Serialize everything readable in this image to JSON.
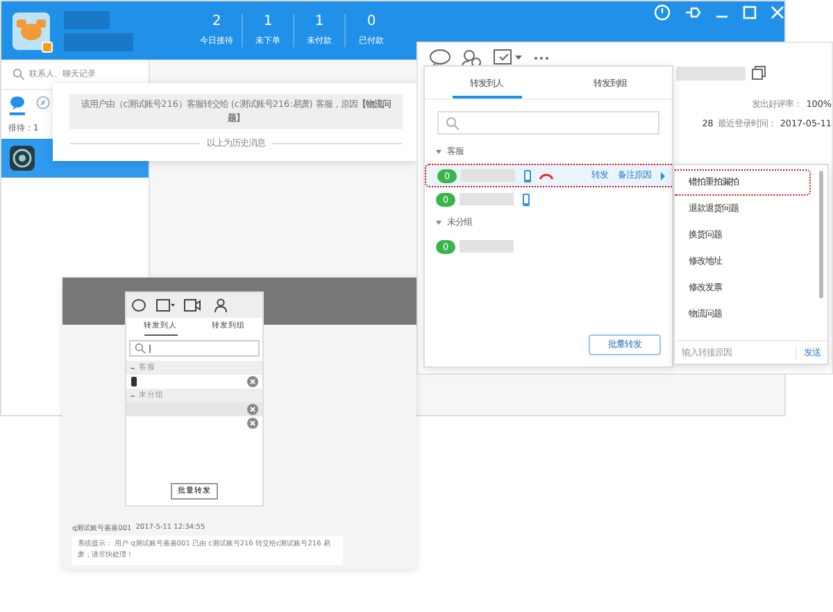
{
  "main_window": {
    "stats": [
      {
        "value": "2",
        "label": "今日接待"
      },
      {
        "value": "1",
        "label": "未下单"
      },
      {
        "value": "1",
        "label": "未付款"
      },
      {
        "value": "0",
        "label": "已付款"
      }
    ],
    "search": {
      "placeholder": "联系人、聊天记录"
    },
    "sidebar_tabs": [
      {
        "kind": "chat",
        "selected": true
      },
      {
        "kind": "compass",
        "selected": false
      }
    ],
    "queue_label": "排待：1",
    "contacts": [
      {
        "selected": true
      }
    ]
  },
  "history_popup": {
    "message": "该用户由（c测试账号216）客服转交给 (c测试账号216:易萧) 客服，原因**【物流问题】**",
    "divider": "以上为历史消息"
  },
  "chat_window": {
    "date_fragment": "28",
    "info": [
      {
        "label": "发出好评率：",
        "value": "100%"
      },
      {
        "label": "最近登录时间：",
        "value": "2017-05-11"
      }
    ]
  },
  "forward_panel": {
    "tabs": [
      {
        "label": "转发到人",
        "selected": true
      },
      {
        "label": "转发到组",
        "selected": false
      }
    ],
    "groups": [
      {
        "name": "客服",
        "expanded": true,
        "members": [
          {
            "count": "0",
            "kind": "mobile",
            "selected": true,
            "actions": [
              "转发",
              "备注原因"
            ]
          },
          {
            "count": "0",
            "kind": "mobile",
            "selected": false
          }
        ]
      },
      {
        "name": "未分组",
        "expanded": true,
        "members": [
          {
            "count": "0",
            "kind": "plain",
            "selected": false
          }
        ]
      }
    ],
    "batch_button": "批量转发"
  },
  "reason_menu": {
    "items": [
      {
        "label": "错拍重拍漏拍",
        "highlighted": true
      },
      {
        "label": "退款退货问题",
        "highlighted": false
      },
      {
        "label": "换货问题",
        "highlighted": false
      },
      {
        "label": "修改地址",
        "highlighted": false
      },
      {
        "label": "修改发票",
        "highlighted": false
      },
      {
        "label": "物流问题",
        "highlighted": false
      }
    ],
    "input": {
      "placeholder": "输入转接原因"
    },
    "send_button": "发送"
  },
  "screenshot": {
    "tabs": [
      {
        "label": "转发到人",
        "selected": true
      },
      {
        "label": "转发到组",
        "selected": false
      }
    ],
    "search": {
      "value": "|"
    },
    "groups": [
      {
        "name": "客服",
        "members": [
          {
            "kind": "mobile",
            "selected": false
          }
        ]
      },
      {
        "name": "未分组",
        "members": [
          {
            "kind": "plain",
            "selected": true
          },
          {
            "kind": "plain",
            "selected": false
          }
        ]
      }
    ],
    "batch_button": "批量转发",
    "message": {
      "sender": "q测试账号嘉嘉001",
      "time": "2017-5-11 12:34:55",
      "text": "系统提示：  用户  q测试账号嘉嘉001  已由  c测试账号216  转交给c测试账号216 易萧，请尽快处理！"
    }
  }
}
